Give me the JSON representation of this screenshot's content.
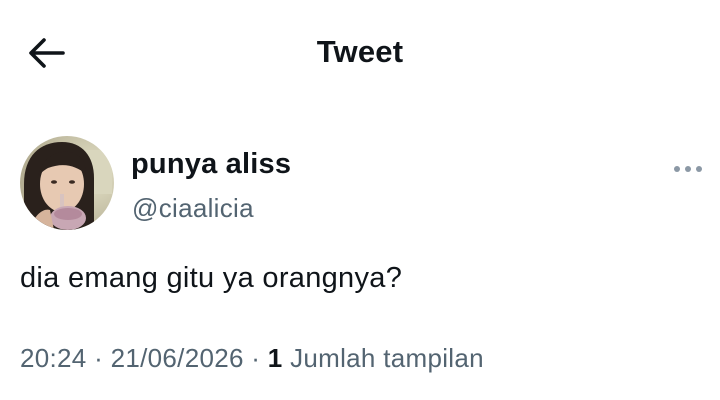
{
  "header": {
    "title": "Tweet",
    "back_icon": "arrow-left-icon"
  },
  "tweet": {
    "author": {
      "display_name": "punya aliss",
      "handle": "@ciaalicia",
      "avatar": "profile-photo"
    },
    "more_icon": "more-horizontal-icon",
    "text": "dia emang gitu ya orangnya?",
    "time": "20:24",
    "separator": "·",
    "date": "21/06/2026",
    "views_count": "1",
    "views_label": "Jumlah tampilan"
  },
  "colors": {
    "text_primary": "#0f1419",
    "text_secondary": "#536471",
    "background": "#ffffff"
  }
}
